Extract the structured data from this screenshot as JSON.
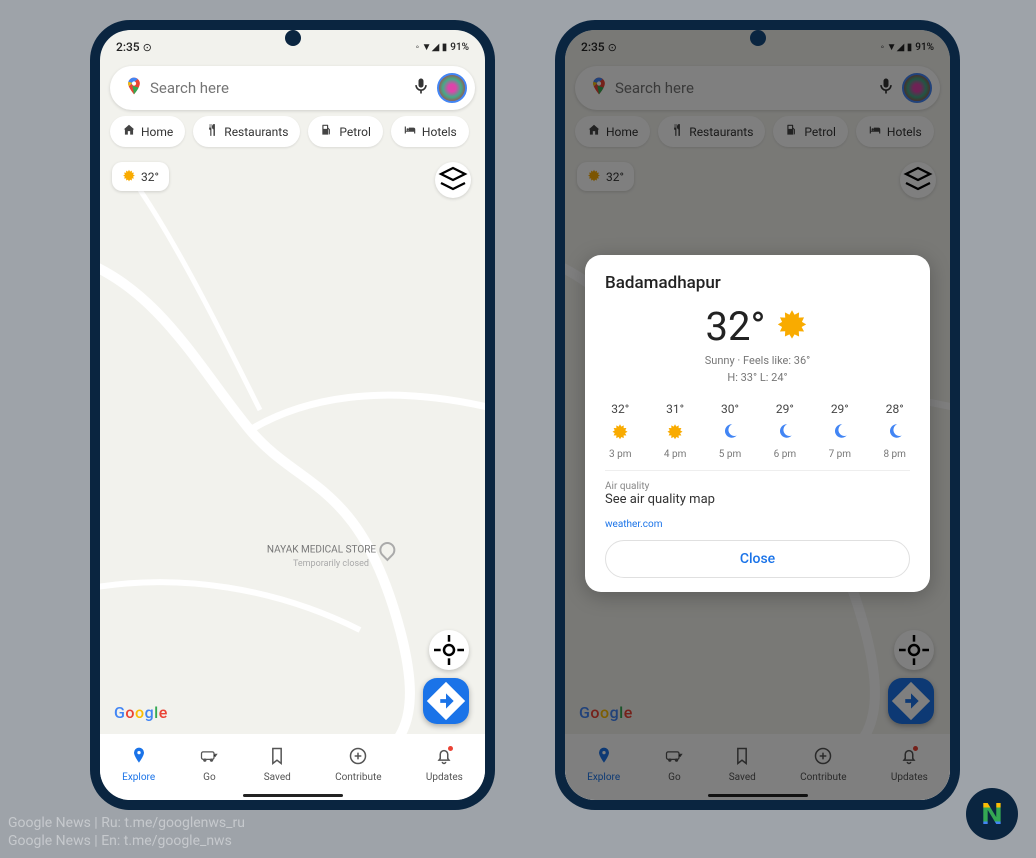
{
  "status": {
    "time": "2:35",
    "battery": "91%"
  },
  "search": {
    "placeholder": "Search here"
  },
  "chips": [
    {
      "icon": "home",
      "label": "Home"
    },
    {
      "icon": "restaurant",
      "label": "Restaurants"
    },
    {
      "icon": "petrol",
      "label": "Petrol"
    },
    {
      "icon": "hotel",
      "label": "Hotels"
    }
  ],
  "weather_chip": {
    "temp": "32°"
  },
  "poi": {
    "name": "NAYAK MEDICAL STORE",
    "note": "Temporarily closed"
  },
  "nav": [
    {
      "key": "explore",
      "label": "Explore",
      "active": true
    },
    {
      "key": "go",
      "label": "Go"
    },
    {
      "key": "saved",
      "label": "Saved"
    },
    {
      "key": "contribute",
      "label": "Contribute"
    },
    {
      "key": "updates",
      "label": "Updates",
      "notif": true
    }
  ],
  "weather_card": {
    "location": "Badamadhapur",
    "temp": "32°",
    "summary": "Sunny · Feels like: 36°",
    "hilo": "H: 33° L: 24°",
    "hours": [
      {
        "t": "32°",
        "icon": "sun",
        "tm": "3 pm"
      },
      {
        "t": "31°",
        "icon": "sun",
        "tm": "4 pm"
      },
      {
        "t": "30°",
        "icon": "moon",
        "tm": "5 pm"
      },
      {
        "t": "29°",
        "icon": "moon",
        "tm": "6 pm"
      },
      {
        "t": "29°",
        "icon": "moon",
        "tm": "7 pm"
      },
      {
        "t": "28°",
        "icon": "moon",
        "tm": "8 pm"
      }
    ],
    "aq_label": "Air quality",
    "aq_link": "See air quality map",
    "source": "weather.com",
    "close": "Close"
  },
  "credits": {
    "l1": "Google News | Ru: t.me/googlenws_ru",
    "l2": "Google News | En: t.me/google_nws"
  }
}
